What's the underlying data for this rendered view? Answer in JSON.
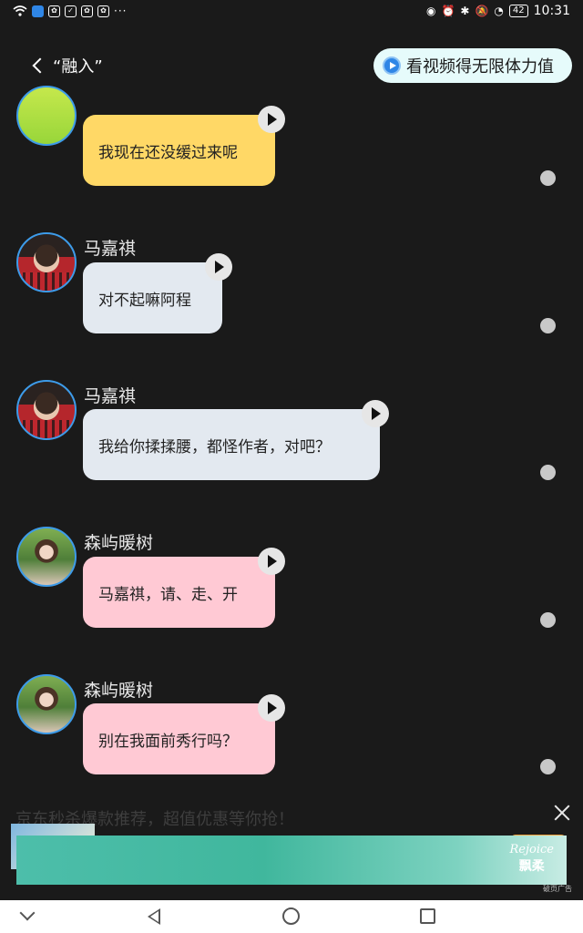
{
  "status_bar": {
    "notification_icons": [
      "wifi-icon",
      "app-notification-icon",
      "baidu-icon",
      "shield-icon",
      "baidu-icon",
      "baidu-icon"
    ],
    "more": "···",
    "battery": "42",
    "time": "10:31"
  },
  "header": {
    "title": "“融入”",
    "video_button": "看视频得无限体力值"
  },
  "messages": [
    {
      "sender": "",
      "text": "我现在还没缓过来呢",
      "bubble_color": "#ffd866"
    },
    {
      "sender": "马嘉祺",
      "text": "对不起嘛阿程",
      "bubble_color": "#e3e9f0"
    },
    {
      "sender": "马嘉祺",
      "text": "我给你揉揉腰，都怪作者，对吧？",
      "bubble_color": "#e3e9f0"
    },
    {
      "sender": "森屿暖树",
      "text": "马嘉祺，请、走、开",
      "bubble_color": "#ffc9d4"
    },
    {
      "sender": "森屿暖树",
      "text": "别在我面前秀行吗？",
      "bubble_color": "#ffc9d4"
    }
  ],
  "ad": {
    "text": "京东秒杀爆款推荐，超值优惠等你抢！",
    "brand_en": "Rejoice",
    "brand_cn": "飘柔",
    "label": "破页广告"
  },
  "colors": {
    "background": "#1a1a1a",
    "avatar_border": "#3d9be9",
    "video_button_bg": "#e6fbfb"
  }
}
